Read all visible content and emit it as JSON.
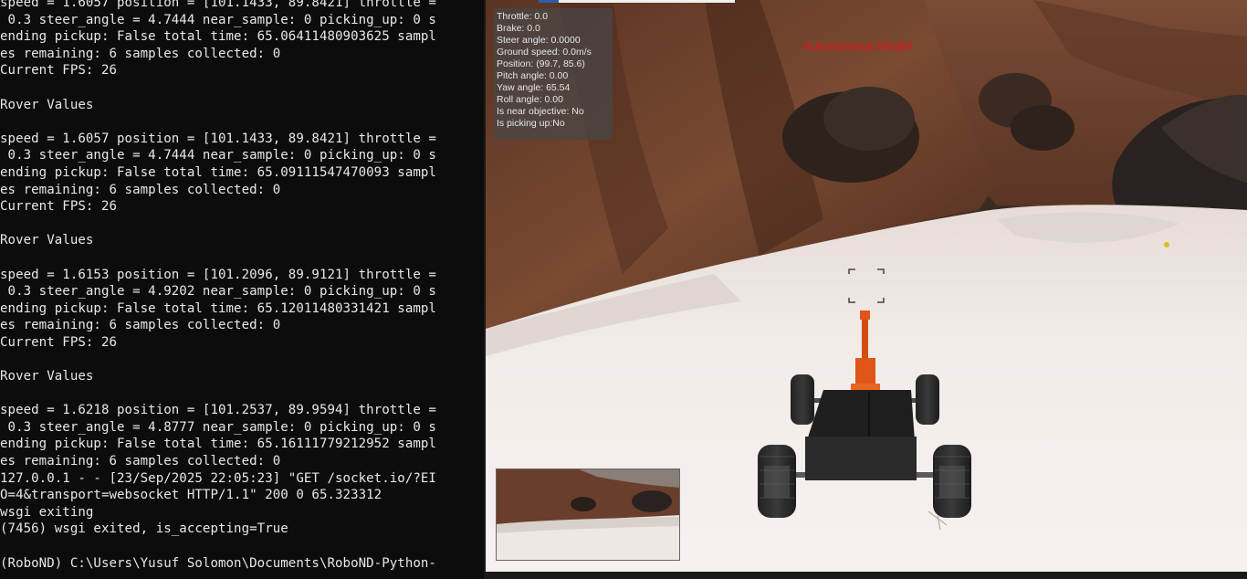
{
  "terminal": {
    "lines": [
      "speed = 1.6057 position = [101.1433, 89.8421] throttle =",
      " 0.3 steer_angle = 4.7444 near_sample: 0 picking_up: 0 s",
      "ending pickup: False total time: 65.06411480903625 sampl",
      "es remaining: 6 samples collected: 0",
      "Current FPS: 26",
      "",
      "Rover Values",
      "",
      "speed = 1.6057 position = [101.1433, 89.8421] throttle =",
      " 0.3 steer_angle = 4.7444 near_sample: 0 picking_up: 0 s",
      "ending pickup: False total time: 65.09111547470093 sampl",
      "es remaining: 6 samples collected: 0",
      "Current FPS: 26",
      "",
      "Rover Values",
      "",
      "speed = 1.6153 position = [101.2096, 89.9121] throttle =",
      " 0.3 steer_angle = 4.9202 near_sample: 0 picking_up: 0 s",
      "ending pickup: False total time: 65.12011480331421 sampl",
      "es remaining: 6 samples collected: 0",
      "Current FPS: 26",
      "",
      "Rover Values",
      "",
      "speed = 1.6218 position = [101.2537, 89.9594] throttle =",
      " 0.3 steer_angle = 4.8777 near_sample: 0 picking_up: 0 s",
      "ending pickup: False total time: 65.16111779212952 sampl",
      "es remaining: 6 samples collected: 0",
      "127.0.0.1 - - [23/Sep/2025 22:05:23] \"GET /socket.io/?EI",
      "O=4&transport=websocket HTTP/1.1\" 200 0 65.323312",
      "wsgi exiting",
      "(7456) wsgi exited, is_accepting=True",
      "",
      "(RoboND) C:\\Users\\Yusuf Solomon\\Documents\\RoboND-Python-"
    ]
  },
  "hud": {
    "throttle": "Throttle: 0.0",
    "brake": "Brake: 0.0",
    "steer": "Steer angle: 0.0000",
    "ground_speed": "Ground speed: 0.0m/s",
    "position": "Position: (99.7, 85.6)",
    "pitch": "Pitch angle: 0.00",
    "yaw": "Yaw angle: 65.54",
    "roll": "Roll angle: 0.00",
    "near_objective": "Is near objective: No",
    "picking_up": "Is picking up:No"
  },
  "mode_label": "Autonomous Mode!",
  "colors": {
    "terminal_bg": "#0c0c0c",
    "terminal_text": "#e8e8e8",
    "mode_label": "#e0141a",
    "rock": "#6b3f2a",
    "sand": "#efe9e6",
    "rover_arm": "#e0551a"
  }
}
